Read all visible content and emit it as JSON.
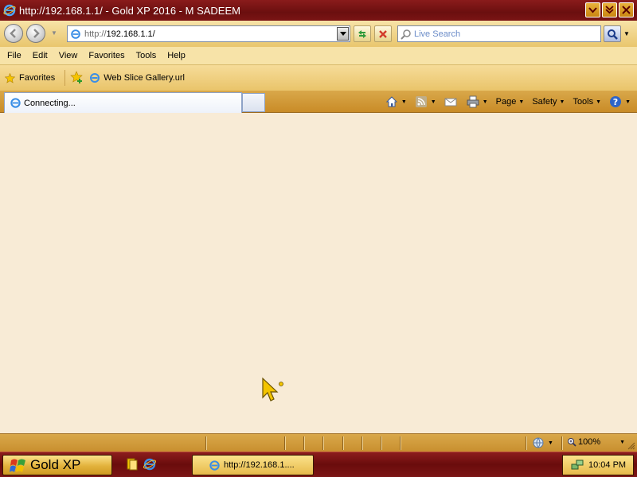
{
  "window": {
    "title": "http://192.168.1.1/ - Gold XP 2016 - M SADEEM"
  },
  "address_bar": {
    "url_scheme": "http://",
    "url_host": "192.168.1.1/"
  },
  "search": {
    "placeholder": "Live Search"
  },
  "menu": {
    "items": [
      "File",
      "Edit",
      "View",
      "Favorites",
      "Tools",
      "Help"
    ]
  },
  "favorites_bar": {
    "favorites_label": "Favorites",
    "links": [
      "Web Slice Gallery.url"
    ]
  },
  "tab": {
    "label": "Connecting..."
  },
  "command_bar": {
    "page_label": "Page",
    "safety_label": "Safety",
    "tools_label": "Tools"
  },
  "status_bar": {
    "zoom": "100%"
  },
  "taskbar": {
    "start_label": "Gold XP",
    "task_label": "http://192.168.1....",
    "clock": "10:04 PM"
  },
  "colors": {
    "title_bar": "#7a1414",
    "toolbar_gold": "#e9c46a",
    "content_bg": "#f8ebd6",
    "taskbar": "#6a0c0c"
  }
}
